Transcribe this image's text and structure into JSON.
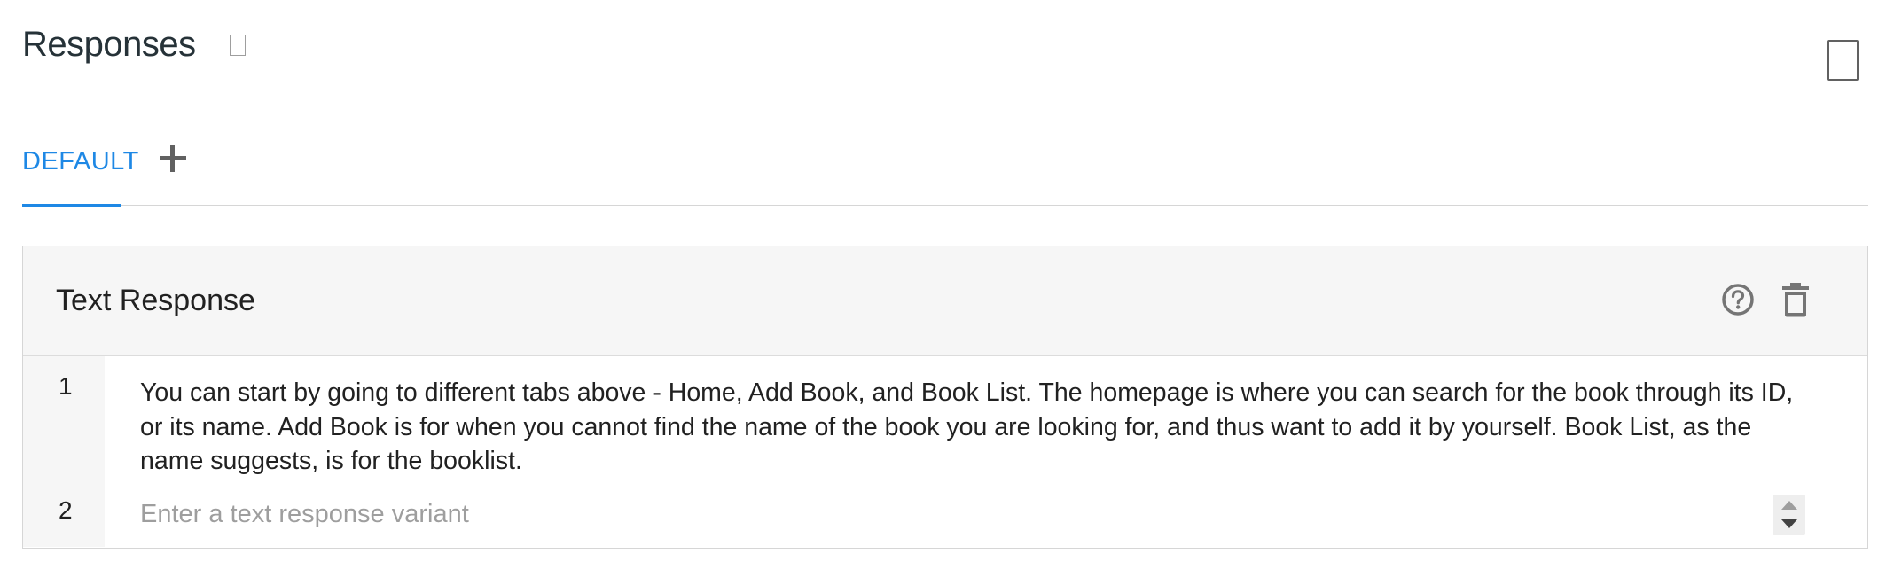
{
  "header": {
    "title": "Responses"
  },
  "tabs": [
    {
      "label": "DEFAULT",
      "active": true
    }
  ],
  "colors": {
    "accent": "#1e88e5",
    "card_header_bg": "#f6f6f6",
    "placeholder": "#9e9e9e"
  },
  "card": {
    "title": "Text Response",
    "icons": [
      "help-circle-icon",
      "trash-icon"
    ],
    "rows": [
      {
        "number": "1",
        "text": "You can start by going to different tabs above - Home, Add Book, and Book List. The homepage is where you can search for the book through its ID, or its name. Add Book is for when you cannot find the name of the book you are looking for, and thus want to add it by yourself. Book List, as the name suggests, is for the booklist."
      },
      {
        "number": "2",
        "placeholder": "Enter a text response variant"
      }
    ]
  }
}
